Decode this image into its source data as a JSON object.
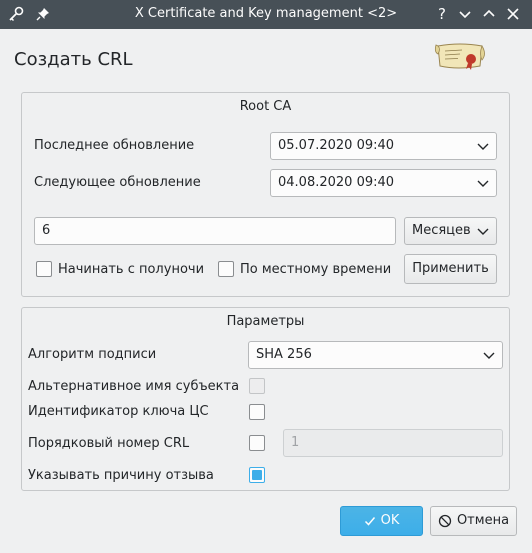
{
  "window": {
    "title": "X Certificate and Key management <2>",
    "help_glyph": "?",
    "min_glyph": "⌄",
    "max_glyph": "⌃",
    "close_glyph": "✕"
  },
  "dialog": {
    "title": "Создать CRL"
  },
  "root_ca": {
    "title": "Root CA",
    "last_update_label": "Последнее обновление",
    "last_update_value": "05.07.2020 09:40",
    "next_update_label": "Следующее обновление",
    "next_update_value": "04.08.2020 09:40",
    "period_value": "6",
    "period_unit": "Месяцев",
    "midnight_label": "Начинать с полуночи",
    "local_time_label": "По местному времени",
    "apply_label": "Применить"
  },
  "params": {
    "title": "Параметры",
    "sig_alg_label": "Алгоритм подписи",
    "sig_alg_value": "SHA 256",
    "alt_name_label": "Альтернативное имя субъекта",
    "key_id_label": "Идентификатор ключа ЦС",
    "crl_number_label": "Порядковый номер CRL",
    "crl_number_value": "1",
    "reason_label": "Указывать причину отзыва",
    "reason_checked": true
  },
  "buttons": {
    "ok_label": "OK",
    "cancel_label": "Отмена"
  },
  "icons": {
    "app": "key-icon",
    "pin": "pin-icon",
    "scroll": "scroll-icon"
  }
}
